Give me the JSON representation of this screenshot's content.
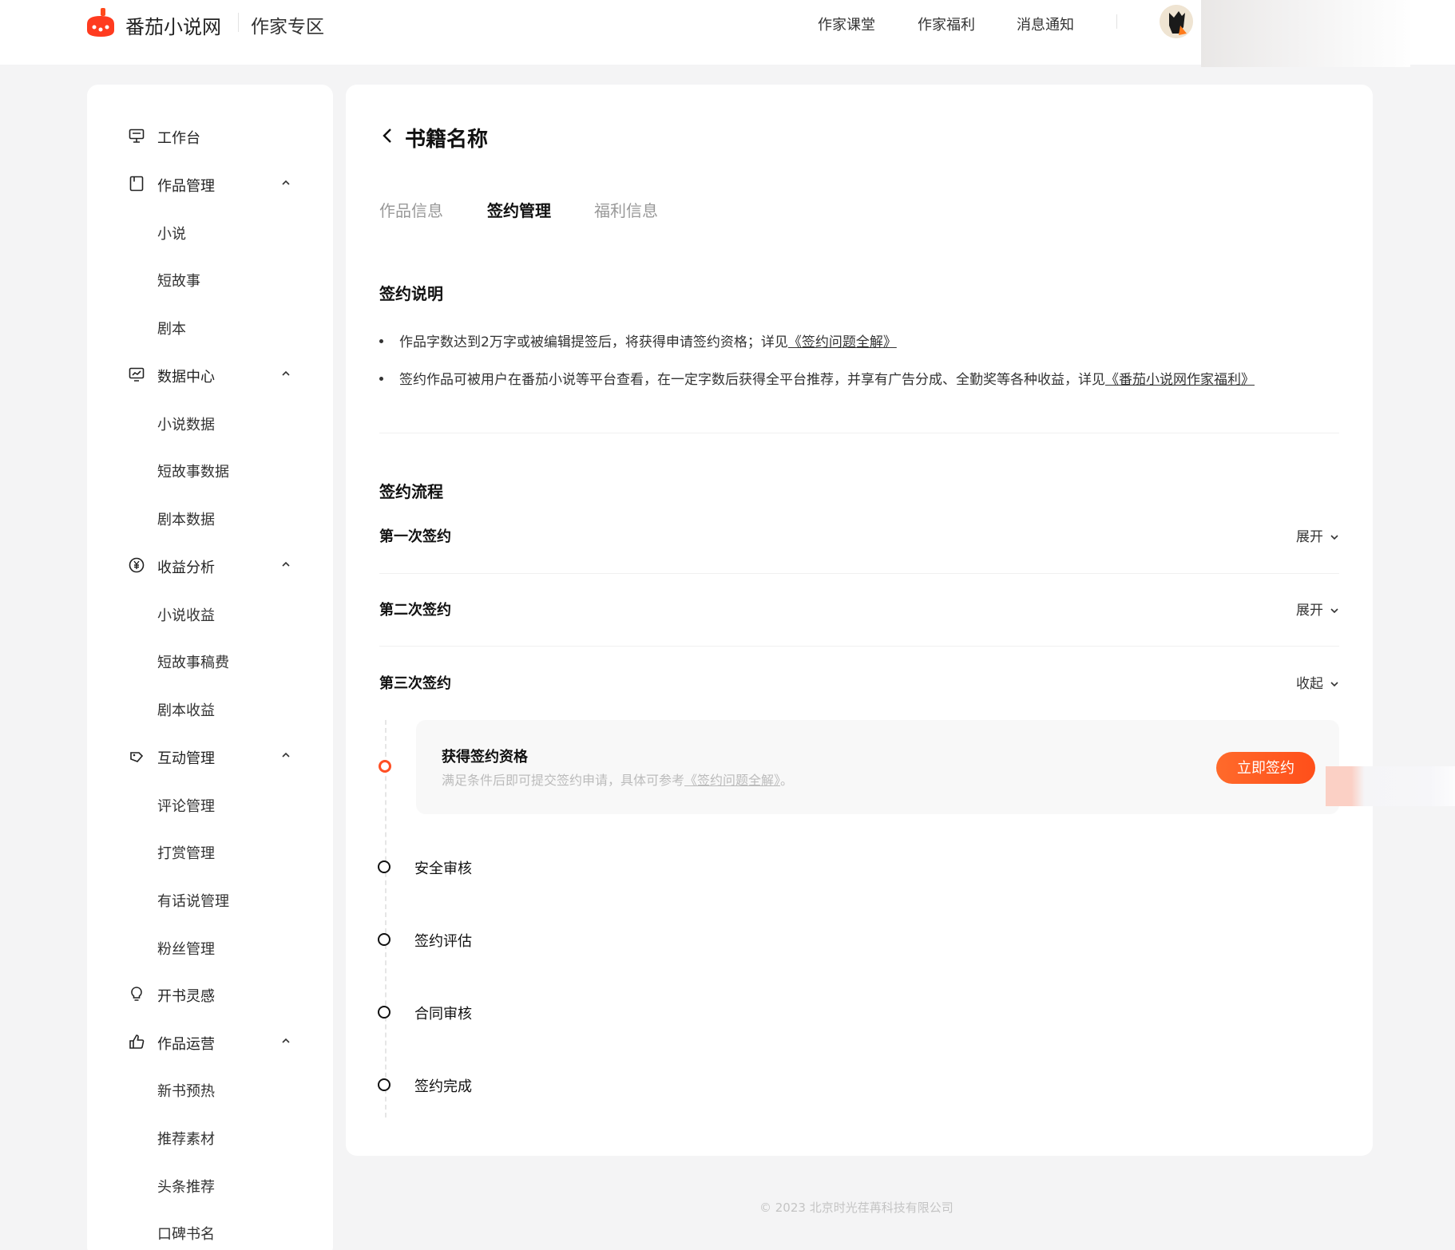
{
  "header": {
    "site_name": "番茄小说网",
    "section": "作家专区",
    "nav": [
      "作家课堂",
      "作家福利",
      "消息通知"
    ]
  },
  "sidebar": {
    "items": [
      {
        "label": "工作台",
        "icon": "monitor-icon",
        "expandable": false,
        "sub": false
      },
      {
        "label": "作品管理",
        "icon": "book-icon",
        "expandable": true,
        "sub": false
      },
      {
        "label": "小说",
        "sub": true
      },
      {
        "label": "短故事",
        "sub": true
      },
      {
        "label": "剧本",
        "sub": true
      },
      {
        "label": "数据中心",
        "icon": "chart-icon",
        "expandable": true,
        "sub": false
      },
      {
        "label": "小说数据",
        "sub": true
      },
      {
        "label": "短故事数据",
        "sub": true
      },
      {
        "label": "剧本数据",
        "sub": true
      },
      {
        "label": "收益分析",
        "icon": "yen-icon",
        "expandable": true,
        "sub": false
      },
      {
        "label": "小说收益",
        "sub": true
      },
      {
        "label": "短故事稿费",
        "sub": true
      },
      {
        "label": "剧本收益",
        "sub": true
      },
      {
        "label": "互动管理",
        "icon": "interact-icon",
        "expandable": true,
        "sub": false
      },
      {
        "label": "评论管理",
        "sub": true
      },
      {
        "label": "打赏管理",
        "sub": true
      },
      {
        "label": "有话说管理",
        "sub": true
      },
      {
        "label": "粉丝管理",
        "sub": true
      },
      {
        "label": "开书灵感",
        "icon": "bulb-icon",
        "expandable": false,
        "sub": false
      },
      {
        "label": "作品运营",
        "icon": "thumb-up-icon",
        "expandable": true,
        "sub": false
      },
      {
        "label": "新书预热",
        "sub": true
      },
      {
        "label": "推荐素材",
        "sub": true
      },
      {
        "label": "头条推荐",
        "sub": true
      },
      {
        "label": "口碑书名",
        "sub": true
      }
    ]
  },
  "main": {
    "title": "书籍名称",
    "tabs": [
      {
        "label": "作品信息",
        "active": false
      },
      {
        "label": "签约管理",
        "active": true
      },
      {
        "label": "福利信息",
        "active": false
      }
    ],
    "explain": {
      "title": "签约说明",
      "bullet1_text": "作品字数达到2万字或被编辑提签后，将获得申请签约资格；详见",
      "bullet1_link": "《签约问题全解》",
      "bullet2_text": "签约作品可被用户在番茄小说等平台查看，在一定字数后获得全平台推荐，并享有广告分成、全勤奖等各种收益，详见",
      "bullet2_link": "《番茄小说网作家福利》"
    },
    "process": {
      "title": "签约流程",
      "rounds": [
        {
          "label": "第一次签约",
          "toggle": "展开"
        },
        {
          "label": "第二次签约",
          "toggle": "展开"
        },
        {
          "label": "第三次签约",
          "toggle": "收起"
        }
      ],
      "current": {
        "title": "获得签约资格",
        "desc_text": "满足条件后即可提交签约申请，具体可参考",
        "desc_link": "《签约问题全解》",
        "desc_end": "。",
        "button": "立即签约"
      },
      "steps": [
        "安全审核",
        "签约评估",
        "合同审核",
        "签约完成"
      ]
    }
  },
  "footer": {
    "copyright": "© 2023 北京时光荏苒科技有限公司"
  },
  "colors": {
    "accent": "#ff4f24",
    "background": "#f4f4f5"
  }
}
